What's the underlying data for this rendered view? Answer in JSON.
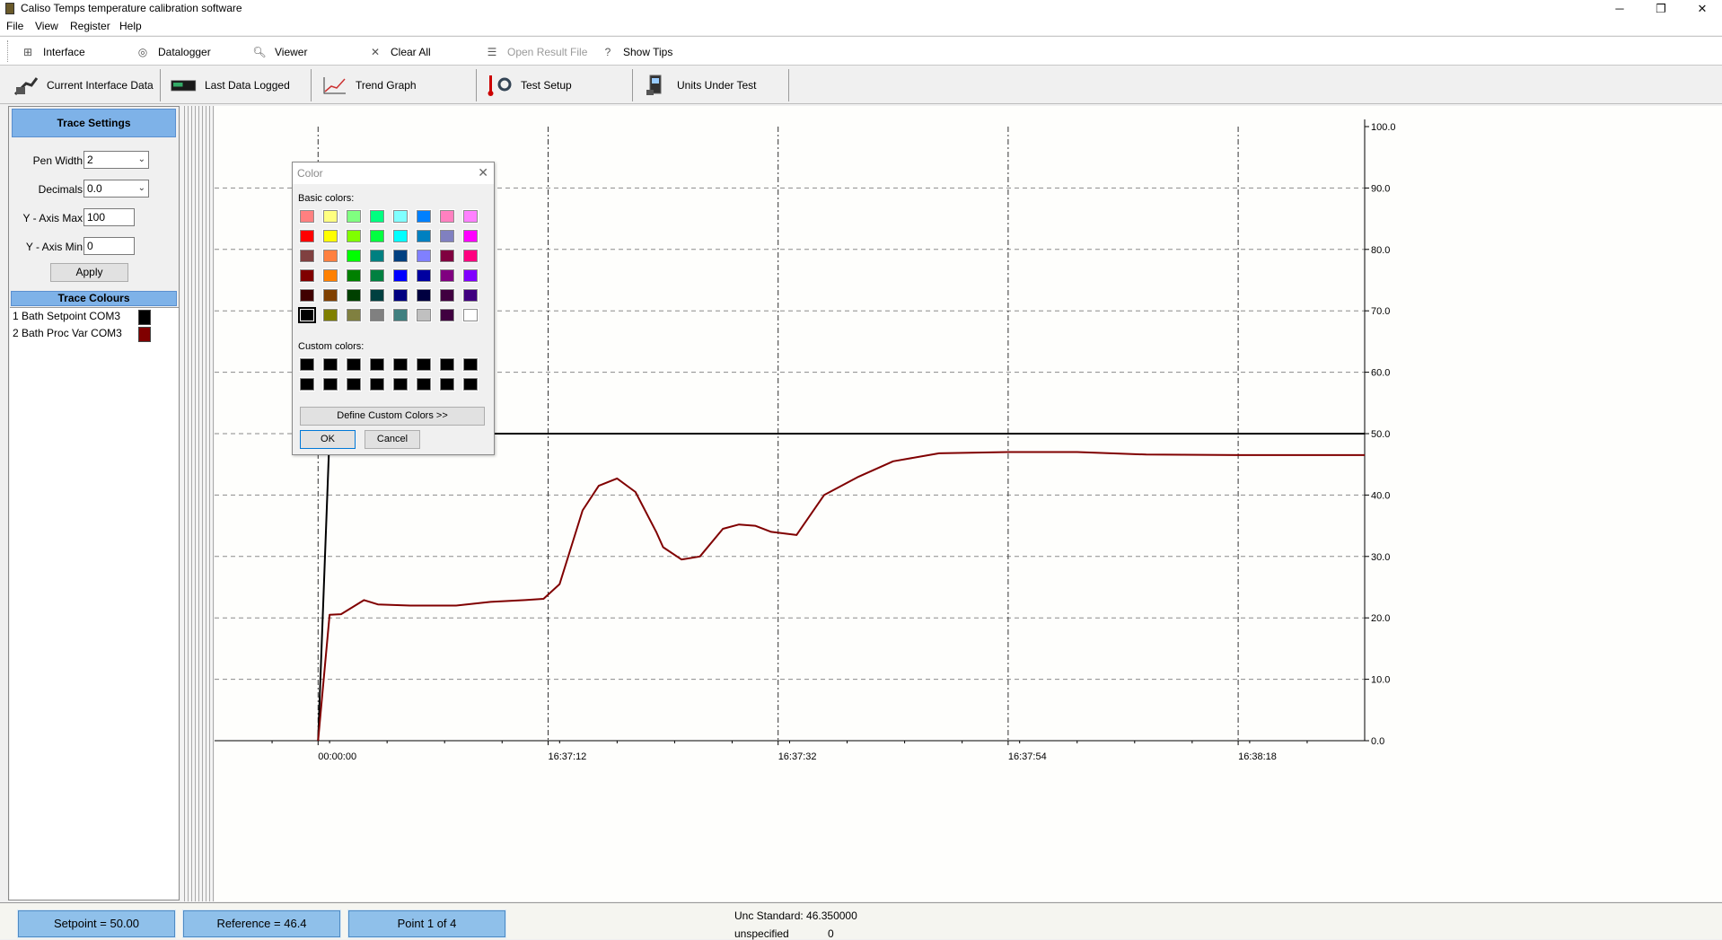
{
  "window": {
    "title": "Caliso Temps temperature calibration software",
    "minimize": "─",
    "maximize": "❐",
    "close": "✕"
  },
  "menu": [
    "File",
    "View",
    "Register",
    "Help"
  ],
  "toolbar": [
    {
      "label": "Interface",
      "icon": "interface-icon",
      "enabled": true
    },
    {
      "label": "Datalogger",
      "icon": "datalogger-icon",
      "enabled": true
    },
    {
      "label": "Viewer",
      "icon": "viewer-icon",
      "enabled": true
    },
    {
      "label": "Clear All",
      "icon": "clear-icon",
      "enabled": true
    },
    {
      "label": "Open Result File",
      "icon": "open-file-icon",
      "enabled": false
    },
    {
      "label": "Show Tips",
      "icon": "tips-icon",
      "enabled": true
    }
  ],
  "tabs": [
    {
      "label": "Current Interface Data",
      "icon": "interface-data-icon"
    },
    {
      "label": "Last Data Logged",
      "icon": "datalogger-device-icon"
    },
    {
      "label": "Trend Graph",
      "icon": "trend-graph-icon"
    },
    {
      "label": "Test Setup",
      "icon": "test-setup-icon"
    },
    {
      "label": "Units Under Test",
      "icon": "units-under-test-icon"
    }
  ],
  "trace_settings": {
    "header": "Trace Settings",
    "pen_width_label": "Pen Width",
    "pen_width_value": "2",
    "decimals_label": "Decimals",
    "decimals_value": "0.0",
    "y_max_label": "Y - Axis Max",
    "y_max_value": "100",
    "y_min_label": "Y - Axis Min",
    "y_min_value": "0",
    "apply_label": "Apply",
    "colours_header": "Trace Colours",
    "traces": [
      {
        "name": "1 Bath  Setpoint COM3",
        "color": "#000000"
      },
      {
        "name": "2 Bath  Proc Var COM3",
        "color": "#800000"
      }
    ]
  },
  "color_dialog": {
    "title": "Color",
    "close": "✕",
    "basic_label": "Basic colors:",
    "custom_label": "Custom colors:",
    "define_label": "Define Custom Colors >>",
    "ok_label": "OK",
    "cancel_label": "Cancel",
    "basic_colors": [
      [
        "#ff8080",
        "#ffff80",
        "#80ff80",
        "#00ff80",
        "#80ffff",
        "#0080ff",
        "#ff80c0",
        "#ff80ff"
      ],
      [
        "#ff0000",
        "#ffff00",
        "#80ff00",
        "#00ff40",
        "#00ffff",
        "#0080c0",
        "#8080c0",
        "#ff00ff"
      ],
      [
        "#804040",
        "#ff8040",
        "#00ff00",
        "#008080",
        "#004080",
        "#8080ff",
        "#800040",
        "#ff0080"
      ],
      [
        "#800000",
        "#ff8000",
        "#008000",
        "#008040",
        "#0000ff",
        "#0000a0",
        "#800080",
        "#8000ff"
      ],
      [
        "#400000",
        "#804000",
        "#004000",
        "#004040",
        "#000080",
        "#000040",
        "#400040",
        "#400080"
      ],
      [
        "#000000",
        "#808000",
        "#808040",
        "#808080",
        "#408080",
        "#c0c0c0",
        "#400040",
        "#ffffff"
      ]
    ],
    "selected": "#000000",
    "custom_colors": [
      [
        "#000000",
        "#000000",
        "#000000",
        "#000000",
        "#000000",
        "#000000",
        "#000000",
        "#000000"
      ],
      [
        "#000000",
        "#000000",
        "#000000",
        "#000000",
        "#000000",
        "#000000",
        "#000000",
        "#000000"
      ]
    ]
  },
  "chart_data": {
    "type": "line",
    "ylim": [
      0,
      100
    ],
    "y_ticks": [
      "0.0",
      "10.0",
      "20.0",
      "30.0",
      "40.0",
      "50.0",
      "60.0",
      "70.0",
      "80.0",
      "90.0",
      "100.0"
    ],
    "x_ticks": [
      "00:00:00",
      "16:37:12",
      "16:37:32",
      "16:37:54",
      "16:38:18"
    ],
    "xlim": [
      -0.45,
      4.55
    ],
    "grid": true,
    "series": [
      {
        "color": "#000000",
        "x": [
          0,
          0.05,
          4.55
        ],
        "y": [
          0,
          50,
          50
        ]
      },
      {
        "color": "#800000",
        "x": [
          0,
          0.05,
          0.1,
          0.2,
          0.26,
          0.4,
          0.6,
          0.75,
          0.9,
          0.98,
          1.05,
          1.15,
          1.22,
          1.3,
          1.38,
          1.47,
          1.5,
          1.58,
          1.66,
          1.76,
          1.83,
          1.9,
          1.97,
          2.08,
          2.2,
          2.35,
          2.5,
          2.7,
          3.0,
          3.3,
          3.6,
          4.0,
          4.3,
          4.55
        ],
        "y": [
          0,
          20.5,
          20.6,
          22.9,
          22.2,
          22.0,
          22.0,
          22.6,
          22.9,
          23.1,
          25.5,
          37.5,
          41.5,
          42.7,
          40.5,
          34.0,
          31.5,
          29.5,
          30.0,
          34.5,
          35.2,
          35.0,
          34.0,
          33.5,
          40.0,
          43.0,
          45.5,
          46.8,
          47.0,
          47.0,
          46.6,
          46.5,
          46.5,
          46.5
        ]
      }
    ]
  },
  "status": {
    "setpoint": "Setpoint = 50.00",
    "reference": "Reference = 46.4",
    "point": "Point 1 of 4",
    "unc_standard": "Unc Standard: 46.350000",
    "unspecified_label": "unspecified",
    "unspecified_value": "0"
  }
}
